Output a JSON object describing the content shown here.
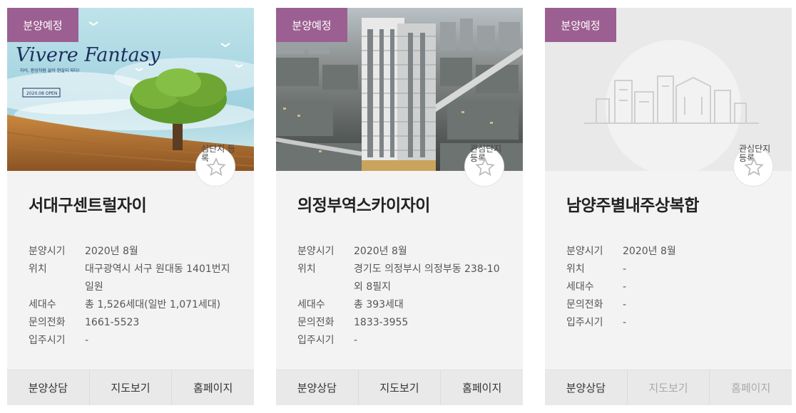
{
  "cards": [
    {
      "status": "분양예정",
      "favorite_label": "심단지 등록",
      "title": "서대구센트럴자이",
      "image_text": {
        "brand": "Vivere Fantasy",
        "tagline": "자이, 환상처럼 삶이 현실이 되다!",
        "open_label": "2020.08 OPEN"
      },
      "info": [
        {
          "label": "분양시기",
          "value": "2020년 8월"
        },
        {
          "label": "위치",
          "value": "대구광역시 서구 원대동 1401번지 일원"
        },
        {
          "label": "세대수",
          "value": "총 1,526세대(일반 1,071세대)"
        },
        {
          "label": "문의전화",
          "value": "1661-5523"
        },
        {
          "label": "입주시기",
          "value": "-"
        }
      ],
      "buttons": [
        "분양상담",
        "지도보기",
        "홈페이지"
      ]
    },
    {
      "status": "분양예정",
      "favorite_label": "관심단지 등록",
      "title": "의정부역스카이자이",
      "info": [
        {
          "label": "분양시기",
          "value": "2020년 8월"
        },
        {
          "label": "위치",
          "value": "경기도 의정부시 의정부동 238-10 외 8필지"
        },
        {
          "label": "세대수",
          "value": "총 393세대"
        },
        {
          "label": "문의전화",
          "value": "1833-3955"
        },
        {
          "label": "입주시기",
          "value": "-"
        }
      ],
      "buttons": [
        "분양상담",
        "지도보기",
        "홈페이지"
      ]
    },
    {
      "status": "분양예정",
      "favorite_label": "관심단지 등록",
      "title": "남양주별내주상복합",
      "info": [
        {
          "label": "분양시기",
          "value": "2020년 8월"
        },
        {
          "label": "위치",
          "value": "-"
        },
        {
          "label": "세대수",
          "value": "-"
        },
        {
          "label": "문의전화",
          "value": "-"
        },
        {
          "label": "입주시기",
          "value": "-"
        }
      ],
      "buttons": [
        "분양상담",
        "지도보기",
        "홈페이지"
      ]
    }
  ],
  "colors": {
    "badge": "#9c5f92",
    "card_bg": "#f3f3f3",
    "button_bar": "#e9e9e9",
    "disabled_text": "#aaaaaa"
  }
}
